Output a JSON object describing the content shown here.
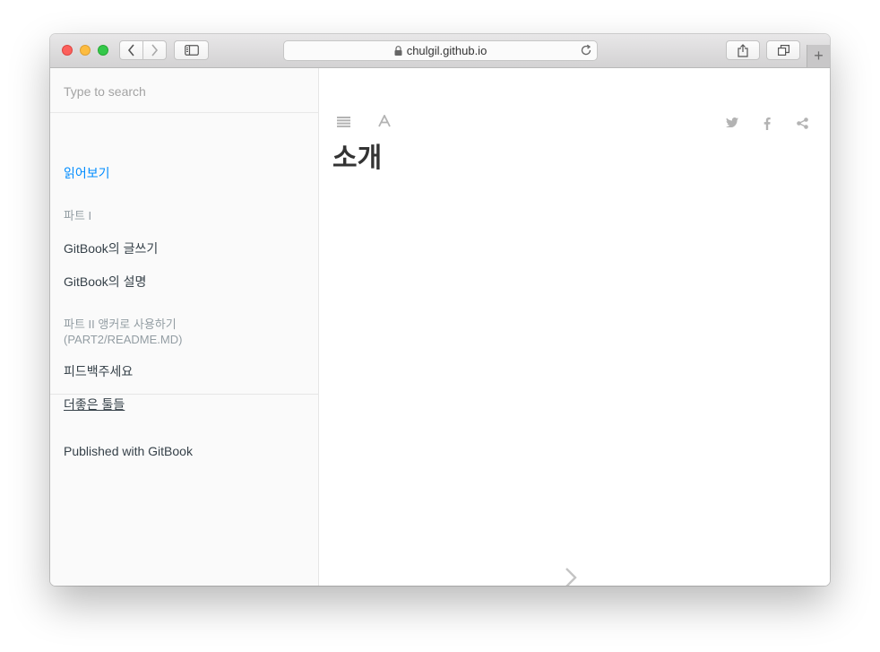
{
  "browser": {
    "address": "chulgil.github.io",
    "new_tab_label": "+"
  },
  "sidebar": {
    "search_placeholder": "Type to search",
    "items": [
      {
        "label": "읽어보기"
      },
      {
        "label": "파트 I"
      },
      {
        "label": "GitBook의 글쓰기"
      },
      {
        "label": "GitBook의 설명"
      },
      {
        "label": "파트 II 앵커로 사용하기"
      },
      {
        "label": "(PART2/README.MD)"
      },
      {
        "label": "피드백주세요"
      },
      {
        "label": "더좋은 툴들"
      }
    ],
    "footer": "Published with GitBook"
  },
  "content": {
    "title": "소개"
  },
  "colors": {
    "accent": "#008cff",
    "sidebar_bg": "#fafafa",
    "text": "#364149",
    "muted": "#939da3"
  },
  "icons": [
    "back-icon",
    "forward-icon",
    "sidebar-toggle-icon",
    "lock-icon",
    "reload-icon",
    "share-icon",
    "tabs-overview-icon",
    "menu-icon",
    "font-settings-icon",
    "twitter-icon",
    "facebook-icon",
    "share-nodes-icon",
    "next-page-icon"
  ]
}
